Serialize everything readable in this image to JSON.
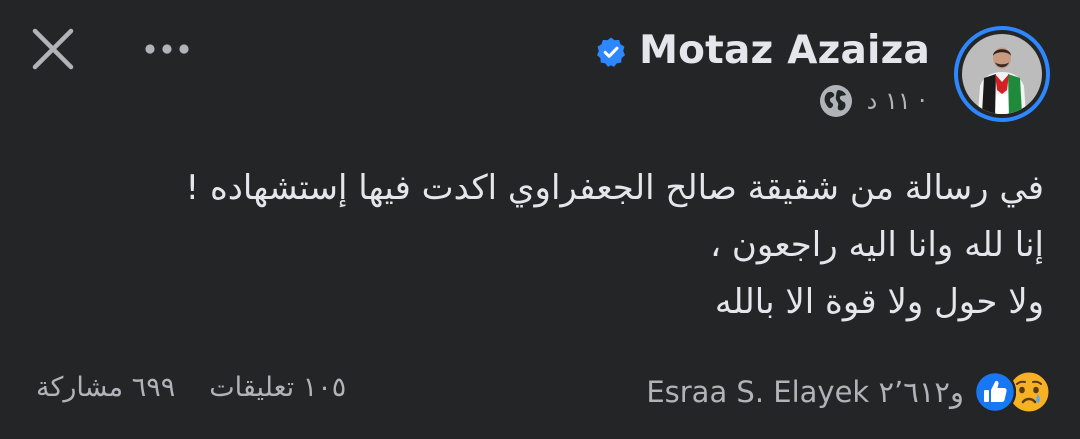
{
  "header": {
    "author_name": "Motaz Azaiza",
    "timestamp": "١١ د ·",
    "close_icon": "close-icon",
    "more_icon": "more-options-icon",
    "verified_icon": "verified-badge-icon",
    "privacy_icon": "globe-icon"
  },
  "post": {
    "lines": [
      "في رسالة من شقيقة صالح الجعفراوي اكدت فيها إستشهاده !",
      "إنا لله وانا اليه راجعون ،",
      "ولا حول ولا قوة الا بالله"
    ]
  },
  "footer": {
    "reactions_label": "Esraa S. Elayek و٢٬٦١٢",
    "comments_count": "١٠٥ تعليقات",
    "shares_count": "٦٩٩ مشاركة",
    "reaction_icons": [
      "like-icon",
      "sad-face-icon"
    ]
  },
  "colors": {
    "background": "#242526",
    "primary_text": "#e4e6eb",
    "secondary_text": "#b0b3b8",
    "accent": "#2d88ff",
    "like_blue": "#1877f2",
    "sad_yellow": "#f7b125"
  }
}
